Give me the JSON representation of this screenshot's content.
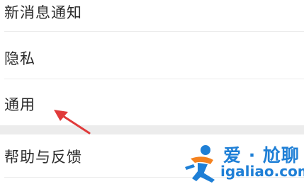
{
  "settings": {
    "group1": [
      {
        "label": "新消息通知"
      },
      {
        "label": "隐私"
      },
      {
        "label": "通用"
      }
    ],
    "group2": [
      {
        "label": "帮助与反馈"
      }
    ]
  },
  "annotation": {
    "arrow_color": "#e03a3a",
    "arrow_target": "通用"
  },
  "watermark": {
    "brand_cn": "爱 · 尬聊",
    "url": "igaliao.com",
    "brand_color": "#1e7fd6",
    "logo_accent_color": "#f5821f"
  }
}
